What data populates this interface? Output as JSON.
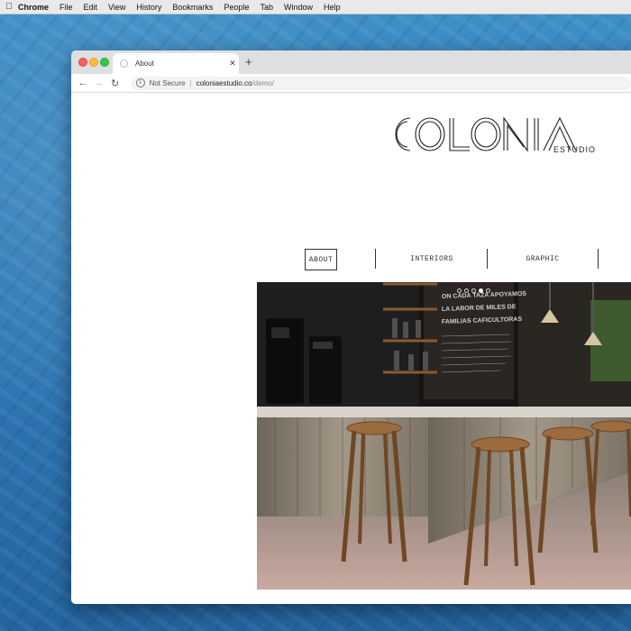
{
  "menubar": {
    "app": "Chrome",
    "items": [
      "File",
      "Edit",
      "View",
      "History",
      "Bookmarks",
      "People",
      "Tab",
      "Window",
      "Help"
    ]
  },
  "browser": {
    "tab_title": "About",
    "security_label": "Not Secure",
    "url_host": "coloniaestudio.co",
    "url_path": "/demo/"
  },
  "site": {
    "logo_text": "COLONIA",
    "logo_subtext": "ESTUDIO",
    "nav": [
      "ABOUT",
      "INTERIORS",
      "GRAPHIC"
    ],
    "active_nav": "ABOUT",
    "slider_dots": 5,
    "active_slide": 4,
    "hero_mural_lines": [
      "ON CADA TAZA APOYAMOS",
      "LA LABOR DE MILES DE",
      "FAMILIAS CAFICULTORAS"
    ]
  },
  "colors": {
    "desktop_blue": "#2e78b5",
    "logo_ink": "#222222",
    "nav_ink": "#333333"
  }
}
